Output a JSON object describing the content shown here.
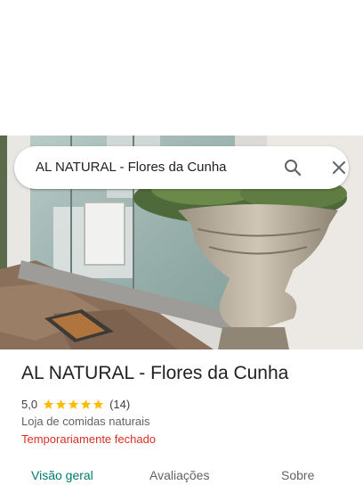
{
  "search": {
    "query": "AL NATURAL - Flores da Cunha",
    "search_icon": "search-icon",
    "close_icon": "close-icon"
  },
  "place": {
    "name": "AL NATURAL - Flores da Cunha",
    "rating": "5,0",
    "stars": 5,
    "review_count": "(14)",
    "category": "Loja de comidas naturais",
    "status": "Temporariamente fechado"
  },
  "tabs": [
    {
      "label": "Visão geral",
      "selected": true
    },
    {
      "label": "Avaliações",
      "selected": false
    },
    {
      "label": "Sobre",
      "selected": false
    }
  ],
  "colors": {
    "accent": "#00796b",
    "star": "#fbbc04",
    "closed": "#d93025",
    "text": "#202124"
  }
}
